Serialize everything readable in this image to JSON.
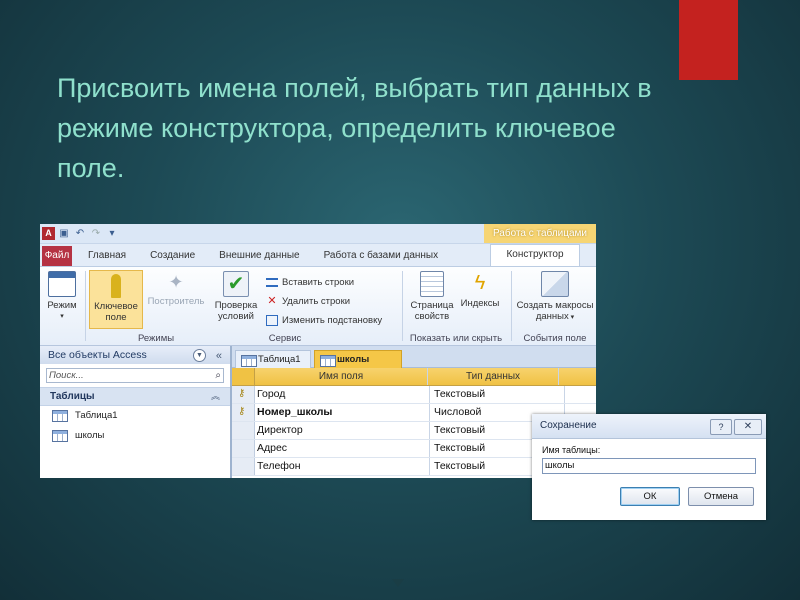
{
  "slide": {
    "title_lines": [
      "Присвоить имена полей, выбрать  тип данных в",
      "режиме конструктора, определить ключевое",
      "поле."
    ],
    "colors": {
      "accent": "#c4221f",
      "title": "#8fe0cc",
      "background": "#1d4a55"
    }
  },
  "access": {
    "contextual_tab_header": "Работа с таблицами",
    "quick_access_icons": [
      "access-logo-icon",
      "save-icon",
      "undo-icon",
      "redo-icon",
      "customize-icon"
    ],
    "app_logo": "A",
    "tabs": [
      "Файл",
      "Главная",
      "Создание",
      "Внешние данные",
      "Работа с базами данных"
    ],
    "active_tab": "Конструктор",
    "ribbon": {
      "mode_button": "Режим",
      "key_button_line1": "Ключевое",
      "key_button_line2": "поле",
      "builder_button": "Построитель",
      "validate_button_line1": "Проверка",
      "validate_button_line2": "условий",
      "insert_rows": "Вставить строки",
      "delete_rows": "Удалить строки",
      "change_lookup": "Изменить подстановку",
      "property_sheet_line1": "Страница",
      "property_sheet_line2": "свойств",
      "indexes": "Индексы",
      "create_macros_line1": "Создать макросы",
      "create_macros_line2": "данных",
      "group_modes": "Режимы",
      "group_service": "Сервис",
      "group_show_hide": "Показать или скрыть",
      "group_field_events": "События поле"
    },
    "nav": {
      "header": "Все объекты Access",
      "search_placeholder": "Поиск...",
      "section": "Таблицы",
      "items": [
        "Таблица1",
        "школы"
      ]
    },
    "doc_tabs": [
      "Таблица1",
      "школы"
    ],
    "grid": {
      "headers": [
        "Имя поля",
        "Тип данных"
      ],
      "rows": [
        {
          "name": "Город",
          "type": "Текстовый",
          "key": true
        },
        {
          "name": "Номер_школы",
          "type": "Числовой",
          "key": true
        },
        {
          "name": "Директор",
          "type": "Текстовый",
          "key": false
        },
        {
          "name": "Адрес",
          "type": "Текстовый",
          "key": false
        },
        {
          "name": "Телефон",
          "type": "Текстовый",
          "key": false
        }
      ]
    }
  },
  "dialog": {
    "title": "Сохранение",
    "help": "?",
    "close": "✕",
    "label": "Имя таблицы:",
    "value": "школы",
    "ok": "ОК",
    "cancel": "Отмена"
  }
}
